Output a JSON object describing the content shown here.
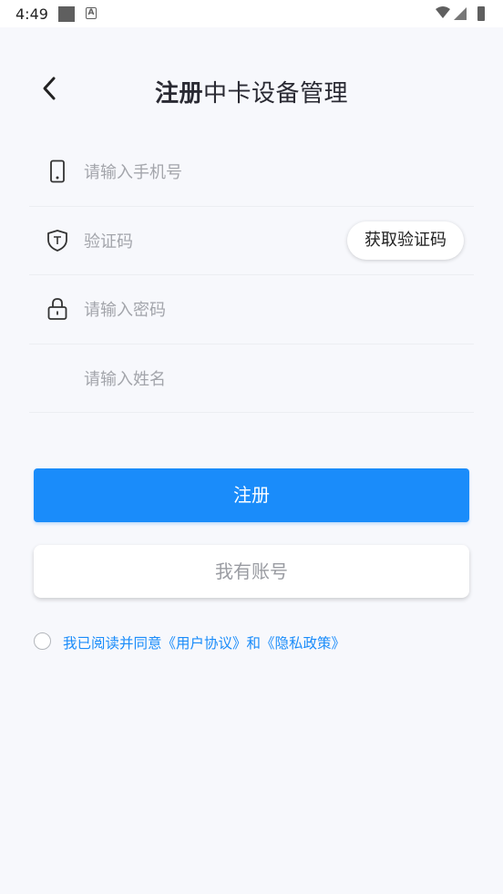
{
  "status_bar": {
    "time": "4:49",
    "a_label": "A"
  },
  "header": {
    "title_bold": "注册",
    "title_rest": "中卡设备管理"
  },
  "form": {
    "phone_placeholder": "请输入手机号",
    "code_placeholder": "验证码",
    "get_code_label": "获取验证码",
    "password_placeholder": "请输入密码",
    "name_placeholder": "请输入姓名"
  },
  "actions": {
    "register_label": "注册",
    "have_account_label": "我有账号"
  },
  "agreement": {
    "text": "我已阅读并同意《用户协议》和《隐私政策》",
    "checked": false
  },
  "colors": {
    "accent": "#1a8cfa",
    "background": "#f7f8fc"
  }
}
